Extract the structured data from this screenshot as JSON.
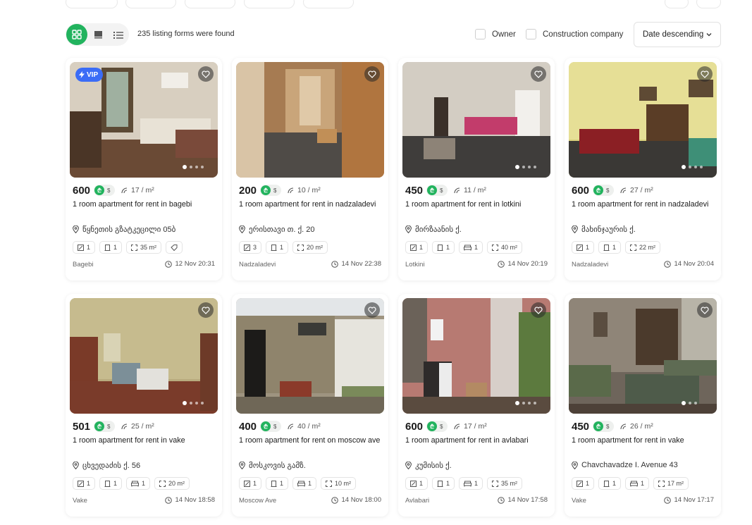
{
  "toolbar": {
    "found_text": "235 listing forms were found",
    "owner_label": "Owner",
    "construction_label": "Construction company",
    "sort_label": "Date descending"
  },
  "colors": {
    "accent": "#22b35e",
    "vip": "#3b6cf6"
  },
  "currency": {
    "gel_symbol": "₾",
    "usd_symbol": "$"
  },
  "listings": [
    {
      "vip": "VIP",
      "price": "600",
      "price_sqm": "17 / m²",
      "title": "1 room apartment for rent in bagebi",
      "address": "წყნეთის გზატკეცილი 05ბ",
      "rooms": "1",
      "bedrooms": "1",
      "area": "35 m²",
      "location": "Bagebi",
      "date": "12 Nov 20:31"
    },
    {
      "price": "200",
      "price_sqm": "10 / m²",
      "title": "1 room apartment for rent in nadzaladevi",
      "address": "ერისთავი თ. ქ. 20",
      "rooms": "3",
      "bedrooms": "1",
      "area": "20 m²",
      "location": "Nadzaladevi",
      "date": "14 Nov 22:38"
    },
    {
      "price": "450",
      "price_sqm": "11 / m²",
      "title": "1 room apartment for rent in lotkini",
      "address": "მირზაანის ქ.",
      "rooms": "1",
      "bedrooms": "1",
      "bathrooms": "1",
      "area": "40 m²",
      "location": "Lotkini",
      "date": "14 Nov 20:19"
    },
    {
      "price": "600",
      "price_sqm": "27 / m²",
      "title": "1 room apartment for rent in nadzaladevi",
      "address": "მახინჯაურის ქ.",
      "rooms": "1",
      "bedrooms": "1",
      "area": "22 m²",
      "location": "Nadzaladevi",
      "date": "14 Nov 20:04"
    },
    {
      "price": "501",
      "price_sqm": "25 / m²",
      "title": "1 room apartment for rent in vake",
      "address": "ცხვედაძის ქ. 56",
      "rooms": "1",
      "bedrooms": "1",
      "bathrooms": "1",
      "area": "20 m²",
      "location": "Vake",
      "date": "14 Nov 18:58"
    },
    {
      "price": "400",
      "price_sqm": "40 / m²",
      "title": "1 room apartment for rent on moscow ave",
      "address": "მოსკოვის გამზ.",
      "rooms": "1",
      "bedrooms": "1",
      "bathrooms": "1",
      "area": "10 m²",
      "location": "Moscow Ave",
      "date": "14 Nov 18:00"
    },
    {
      "price": "600",
      "price_sqm": "17 / m²",
      "title": "1 room apartment for rent in avlabari",
      "address": "კუმისის ქ.",
      "rooms": "1",
      "bedrooms": "1",
      "bathrooms": "1",
      "area": "35 m²",
      "location": "Avlabari",
      "date": "14 Nov 17:58"
    },
    {
      "price": "450",
      "price_sqm": "26 / m²",
      "title": "1 room apartment for rent in vake",
      "address": "Chavchavadze I. Avenue 43",
      "rooms": "1",
      "bedrooms": "1",
      "bathrooms": "1",
      "area": "17 m²",
      "location": "Vake",
      "date": "14 Nov 17:17"
    }
  ]
}
